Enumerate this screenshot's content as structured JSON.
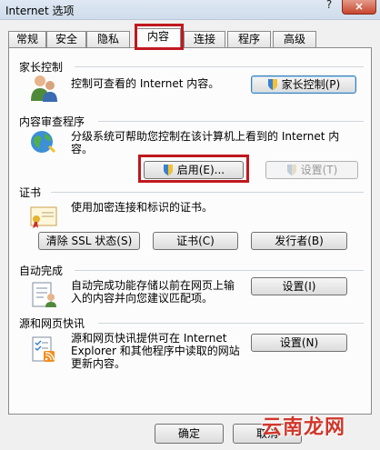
{
  "window": {
    "title": "Internet 选项",
    "help": "?",
    "close": "×"
  },
  "tabs": [
    "常规",
    "安全",
    "隐私",
    "内容",
    "连接",
    "程序",
    "高级"
  ],
  "parental": {
    "title": "家长控制",
    "text": "控制可查看的 Internet 内容。",
    "button": "家长控制(P)"
  },
  "advisor": {
    "title": "内容审查程序",
    "text_line1": "分级系统可帮助您控制在该计算机上看到的 Internet 内",
    "text_line2": "容。",
    "enable_button": "启用(E)...",
    "settings_button": "设置(T)"
  },
  "certs": {
    "title": "证书",
    "text": "使用加密连接和标识的证书。",
    "clear_ssl": "清除 SSL 状态(S)",
    "certificates": "证书(C)",
    "publishers": "发行者(B)"
  },
  "autocomplete": {
    "title": "自动完成",
    "text_line1": "自动完成功能存储以前在网页上输",
    "text_line2": "入的内容并向您建议匹配项。",
    "settings_button": "设置(I)"
  },
  "feeds": {
    "title": "源和网页快讯",
    "text_line1": "源和网页快讯提供可在 Internet",
    "text_line2": "Explorer 和其他程序中读取的网站",
    "text_line3": "更新内容。",
    "settings_button": "设置(N)"
  },
  "footer": {
    "ok": "确定",
    "cancel": "取消"
  },
  "watermark": "云南龙网"
}
